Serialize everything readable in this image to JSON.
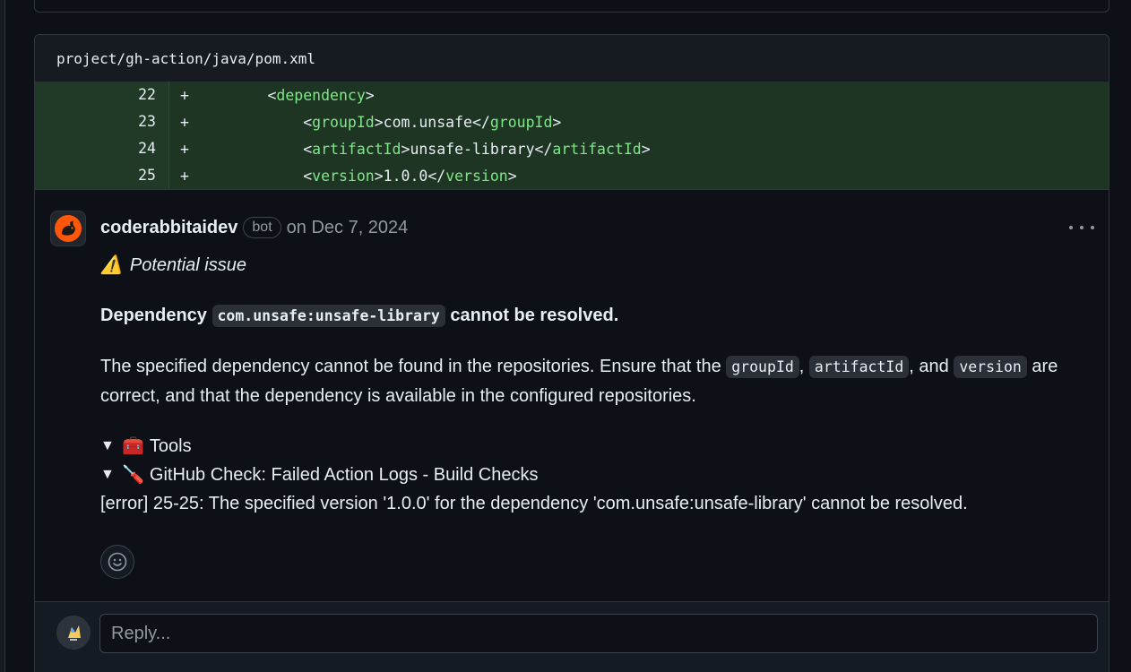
{
  "file": {
    "path": "project/gh-action/java/pom.xml"
  },
  "diff": {
    "lines": [
      {
        "num": "22",
        "marker": "+",
        "indent": "        ",
        "open": "<",
        "tag": "dependency",
        "close": ">",
        "text": "",
        "open2": "",
        "tag2": "",
        "close2": ""
      },
      {
        "num": "23",
        "marker": "+",
        "indent": "            ",
        "open": "<",
        "tag": "groupId",
        "close": ">",
        "text": "com.unsafe",
        "open2": "</",
        "tag2": "groupId",
        "close2": ">"
      },
      {
        "num": "24",
        "marker": "+",
        "indent": "            ",
        "open": "<",
        "tag": "artifactId",
        "close": ">",
        "text": "unsafe-library",
        "open2": "</",
        "tag2": "artifactId",
        "close2": ">"
      },
      {
        "num": "25",
        "marker": "+",
        "indent": "            ",
        "open": "<",
        "tag": "version",
        "close": ">",
        "text": "1.0.0",
        "open2": "</",
        "tag2": "version",
        "close2": ">"
      }
    ]
  },
  "comment": {
    "author": "coderabbitaidev",
    "badge": "bot",
    "date": "on Dec 7, 2024",
    "warning_icon": "⚠️",
    "potential_issue": "Potential issue",
    "heading_pre": "Dependency",
    "heading_code": "com.unsafe:unsafe-library",
    "heading_post": "cannot be resolved.",
    "para_1": "The specified dependency cannot be found in the repositories. Ensure that the",
    "para_code_1": "groupId",
    "para_sep_1": ",",
    "para_code_2": "artifactId",
    "para_sep_2": ", and",
    "para_code_3": "version",
    "para_2": "are correct, and that the dependency is available in the configured repositories.",
    "tools_icon": "🧰",
    "tools_label": "Tools",
    "check_icon": "🪛",
    "check_label": "GitHub Check: Failed Action Logs - Build Checks",
    "error_line": "[error] 25-25: The specified version '1.0.0' for the dependency 'com.unsafe:unsafe-library' cannot be resolved.",
    "triangle": "▼"
  },
  "reply": {
    "placeholder": "Reply..."
  },
  "colors": {
    "diff_added_bg": "#1f3524",
    "tag_green": "#7ee787",
    "brand_orange": "#ff570a"
  },
  "icons": [
    "coderabbit-avatar",
    "more-options-icon",
    "warning-icon",
    "toolbox-icon",
    "screwdriver-icon",
    "smiley-icon",
    "user-avatar"
  ]
}
